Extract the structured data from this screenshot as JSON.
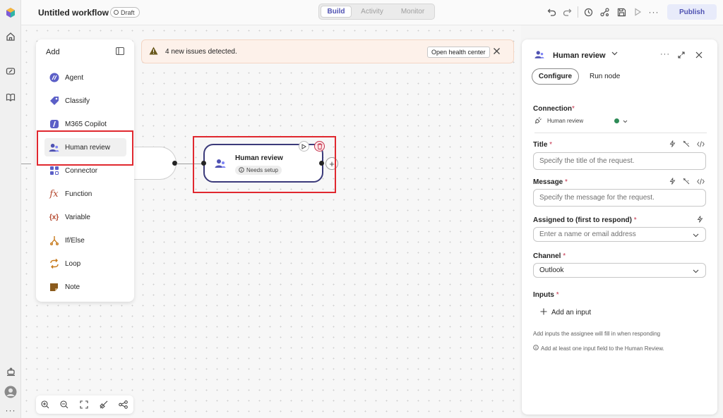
{
  "topbar": {
    "title": "Untitled workflow",
    "draft_label": "Draft",
    "tabs": [
      {
        "label": "Build",
        "active": true
      },
      {
        "label": "Activity",
        "active": false
      },
      {
        "label": "Monitor",
        "active": false
      }
    ],
    "publish_label": "Publish"
  },
  "banner": {
    "text": "4 new issues detected.",
    "button": "Open health center"
  },
  "add_panel": {
    "header": "Add",
    "items": [
      {
        "label": "Agent",
        "icon": "agent-icon"
      },
      {
        "label": "Classify",
        "icon": "classify-icon"
      },
      {
        "label": "M365 Copilot",
        "icon": "copilot-icon"
      },
      {
        "label": "Human review",
        "icon": "human-review-icon",
        "selected": true
      },
      {
        "label": "Connector",
        "icon": "connector-icon"
      },
      {
        "label": "Function",
        "icon": "function-icon"
      },
      {
        "label": "Variable",
        "icon": "variable-icon"
      },
      {
        "label": "If/Else",
        "icon": "if-else-icon"
      },
      {
        "label": "Loop",
        "icon": "loop-icon"
      },
      {
        "label": "Note",
        "icon": "note-icon"
      }
    ]
  },
  "node": {
    "title": "Human review",
    "badge": "Needs setup"
  },
  "panel": {
    "title": "Human review",
    "tabs": {
      "configure": "Configure",
      "run": "Run node"
    },
    "connection": {
      "label": "Connection",
      "value": "Human review"
    },
    "title_field": {
      "label": "Title",
      "placeholder": "Specify the title of the request."
    },
    "message_field": {
      "label": "Message",
      "placeholder": "Specify the message for the request."
    },
    "assigned_field": {
      "label": "Assigned to (first to respond)",
      "placeholder": "Enter a name or email address"
    },
    "channel_field": {
      "label": "Channel",
      "value": "Outlook"
    },
    "inputs": {
      "label": "Inputs",
      "add_label": "Add an input",
      "help": "Add inputs the assignee will fill in when responding",
      "warning": "Add at least one input field to the Human Review."
    }
  },
  "colors": {
    "accent": "#4f52b2",
    "highlight": "#e0282f",
    "banner_bg": "#fdf1ea",
    "status_green": "#2e8b57"
  }
}
